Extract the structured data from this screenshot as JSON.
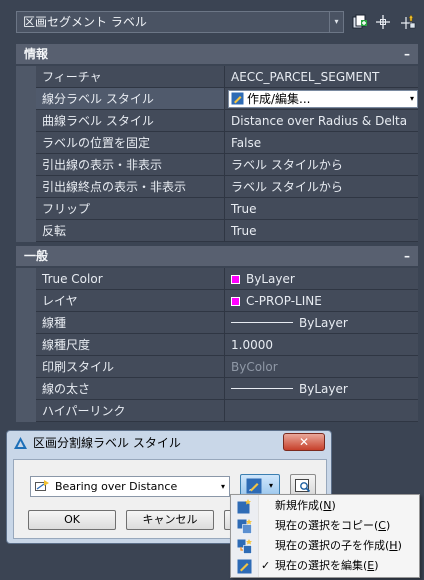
{
  "toolbar": {
    "object_type": "区画セグメント ラベル",
    "dropdown_arrow": "▾"
  },
  "sections": [
    {
      "title": "情報",
      "collapse": "–",
      "rows": [
        {
          "name": "フィーチャ",
          "value": "AECC_PARCEL_SEGMENT"
        },
        {
          "name": "線分ラベル スタイル",
          "value": "作成/編集..."
        },
        {
          "name": "曲線ラベル スタイル",
          "value": "Distance over Radius & Delta"
        },
        {
          "name": "ラベルの位置を固定",
          "value": "False"
        },
        {
          "name": "引出線の表示・非表示",
          "value": "ラベル スタイルから"
        },
        {
          "name": "引出線終点の表示・非表示",
          "value": "ラベル スタイルから"
        },
        {
          "name": "フリップ",
          "value": "True"
        },
        {
          "name": "反転",
          "value": "True"
        }
      ]
    },
    {
      "title": "一般",
      "collapse": "–",
      "rows": [
        {
          "name": "True Color",
          "value": "ByLayer"
        },
        {
          "name": "レイヤ",
          "value": "C-PROP-LINE"
        },
        {
          "name": "線種",
          "value": "ByLayer"
        },
        {
          "name": "線種尺度",
          "value": "1.0000"
        },
        {
          "name": "印刷スタイル",
          "value": "ByColor"
        },
        {
          "name": "線の太さ",
          "value": "ByLayer"
        },
        {
          "name": "ハイパーリンク",
          "value": ""
        }
      ]
    }
  ],
  "colors": {
    "swatch": "#ff00ff",
    "panel_bg": "#3b4453",
    "dialog_bg": "#c9d7e8"
  },
  "dialog": {
    "title": "区画分割線ラベル スタイル",
    "close": "✕",
    "style_value": "Bearing over Distance",
    "ok": "OK",
    "cancel": "キャンセル"
  },
  "menu": {
    "items": [
      {
        "label": "新規作成(",
        "key": "N",
        "suffix": ")",
        "checked": false,
        "icon": "new-style-icon"
      },
      {
        "label": "現在の選択をコピー(",
        "key": "C",
        "suffix": ")",
        "checked": false,
        "icon": "copy-style-icon"
      },
      {
        "label": "現在の選択の子を作成(",
        "key": "H",
        "suffix": ")",
        "checked": false,
        "icon": "child-style-icon"
      },
      {
        "label": "現在の選択を編集(",
        "key": "E",
        "suffix": ")",
        "checked": true,
        "icon": "edit-style-icon"
      }
    ],
    "check_mark": "✓"
  }
}
